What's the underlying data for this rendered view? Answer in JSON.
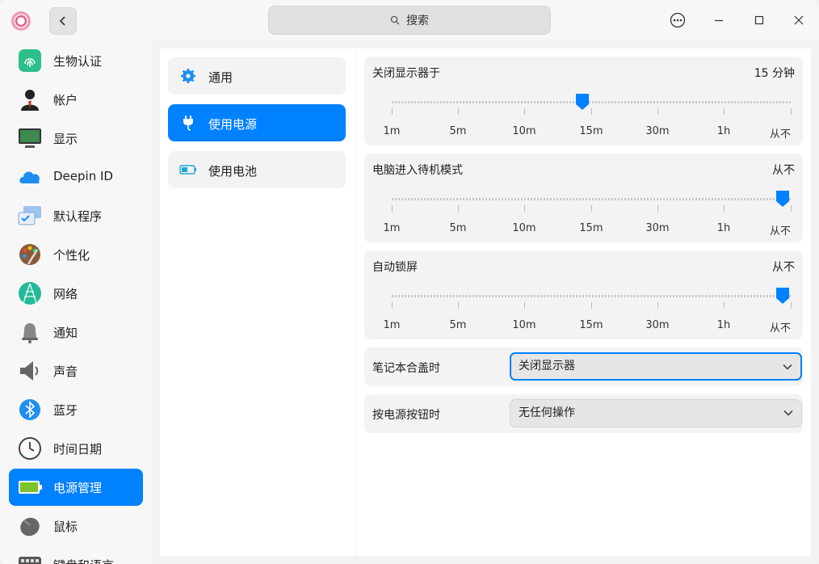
{
  "titlebar": {
    "search_placeholder": "搜索"
  },
  "sidebar": {
    "items": [
      {
        "label": "生物认证",
        "icon": "fingerprint-icon"
      },
      {
        "label": "帐户",
        "icon": "account-icon"
      },
      {
        "label": "显示",
        "icon": "display-icon"
      },
      {
        "label": "Deepin ID",
        "icon": "cloud-icon"
      },
      {
        "label": "默认程序",
        "icon": "default-apps-icon"
      },
      {
        "label": "个性化",
        "icon": "palette-icon"
      },
      {
        "label": "网络",
        "icon": "network-icon"
      },
      {
        "label": "通知",
        "icon": "bell-icon"
      },
      {
        "label": "声音",
        "icon": "speaker-icon"
      },
      {
        "label": "蓝牙",
        "icon": "bluetooth-icon"
      },
      {
        "label": "时间日期",
        "icon": "clock-icon"
      },
      {
        "label": "电源管理",
        "icon": "battery-icon",
        "active": true
      },
      {
        "label": "鼠标",
        "icon": "mouse-icon"
      },
      {
        "label": "键盘和语言",
        "icon": "keyboard-icon"
      }
    ]
  },
  "subnav": {
    "items": [
      {
        "label": "通用",
        "icon": "gear-icon"
      },
      {
        "label": "使用电源",
        "icon": "plug-icon",
        "active": true
      },
      {
        "label": "使用电池",
        "icon": "battery-small-icon"
      }
    ]
  },
  "sliders": [
    {
      "title": "关闭显示器于",
      "value": "15 分钟",
      "position": "15m"
    },
    {
      "title": "电脑进入待机模式",
      "value": "从不",
      "position": "从不"
    },
    {
      "title": "自动锁屏",
      "value": "从不",
      "position": "从不"
    }
  ],
  "ticks": [
    "1m",
    "5m",
    "10m",
    "15m",
    "30m",
    "1h",
    "从不"
  ],
  "lid": {
    "label": "笔记本合盖时",
    "selected": "关闭显示器"
  },
  "power_button": {
    "label": "按电源按钮时",
    "selected": "无任何操作"
  },
  "colors": {
    "accent": "#0081ff"
  }
}
